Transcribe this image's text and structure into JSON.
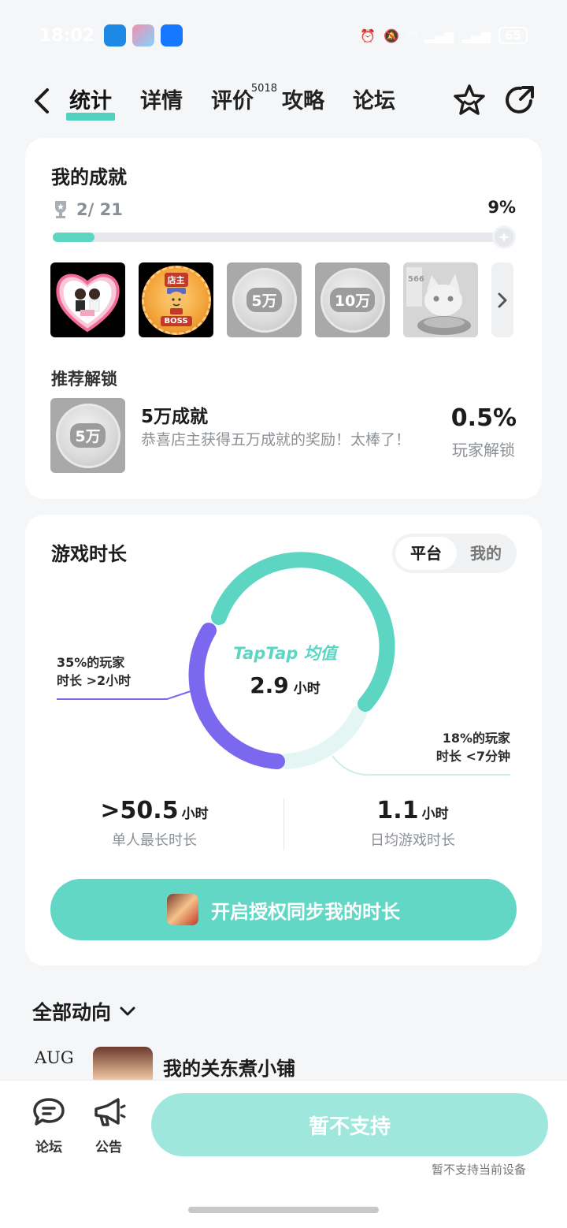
{
  "status_bar": {
    "time": "18:02",
    "battery": "65"
  },
  "nav": {
    "tabs": [
      {
        "label": "统计",
        "active": true
      },
      {
        "label": "详情"
      },
      {
        "label": "评价",
        "badge": "5018"
      },
      {
        "label": "攻略"
      },
      {
        "label": "论坛"
      }
    ]
  },
  "achievements": {
    "title": "我的成就",
    "count": "2/ 21",
    "percent": "9%",
    "progress": 0.09,
    "badges": [
      {
        "name": "wedding"
      },
      {
        "name": "boss",
        "top_text": "店主",
        "bottom_text": "BOSS"
      },
      {
        "name": "5wan",
        "text": "5万"
      },
      {
        "name": "10wan",
        "text": "10万"
      },
      {
        "name": "cat",
        "text": "566"
      }
    ],
    "recommend_title": "推荐解锁",
    "recommend": {
      "name": "5万成就",
      "badge_text": "5万",
      "desc": "恭喜店主获得五万成就的奖励！太棒了！",
      "pct": "0.5%",
      "pct_label": "玩家解锁"
    }
  },
  "playtime": {
    "title": "游戏时长",
    "toggle": {
      "platform": "平台",
      "mine": "我的"
    },
    "center_label": "TapTap 均值",
    "avg_value": "2.9",
    "avg_unit": "小时",
    "note_left": [
      "35%的玩家",
      "时长 >2小时"
    ],
    "note_right": [
      "18%的玩家",
      "时长 <7分钟"
    ],
    "ring": {
      "over_2h_pct": 35,
      "under_7min_pct": 18
    },
    "stats": [
      {
        "value": ">50.5",
        "unit": "小时",
        "label": "单人最长时长"
      },
      {
        "value": "1.1",
        "unit": "小时",
        "label": "日均游戏时长"
      }
    ],
    "sync_button": "开启授权同步我的时长"
  },
  "activity": {
    "title": "全部动向",
    "month": "AUG",
    "item_name": "我的关东煮小铺"
  },
  "bottom_bar": {
    "forum": "论坛",
    "notice": "公告",
    "main_button": "暂不支持",
    "note": "暂不支持当前设备"
  },
  "colors": {
    "accent": "#5dd5c3",
    "purple": "#7b68ee",
    "disabled_button": "#9fe7dc"
  }
}
